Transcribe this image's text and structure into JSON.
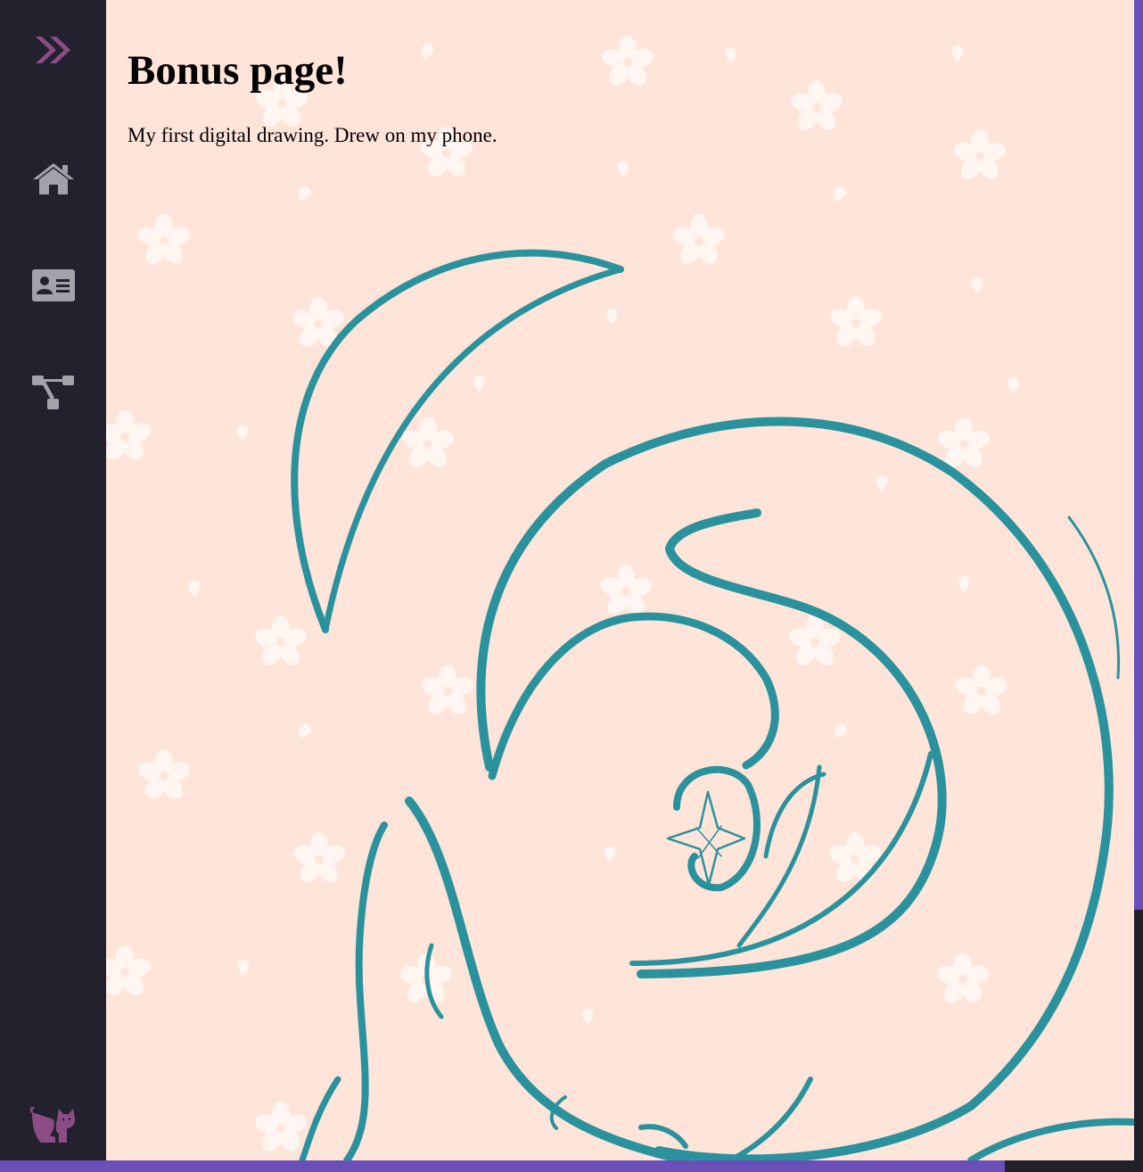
{
  "page": {
    "title": "Bonus page!",
    "caption": "My first digital drawing. Drew on my phone."
  },
  "sidebar": {
    "items": [
      {
        "icon": "double-chevron-right-icon",
        "color": "#8c4d86"
      },
      {
        "icon": "home-icon",
        "color": "#a3a1a9"
      },
      {
        "icon": "id-card-icon",
        "color": "#a3a1a9"
      },
      {
        "icon": "sitemap-icon",
        "color": "#a3a1a9"
      },
      {
        "icon": "cat-icon",
        "color": "#8c4d86"
      }
    ]
  },
  "colors": {
    "sidebar_bg": "#23212d",
    "page_bg": "#ffe4da",
    "accent": "#6a4fb8",
    "ink": "#2a929c",
    "flower": "#fff6f1"
  }
}
